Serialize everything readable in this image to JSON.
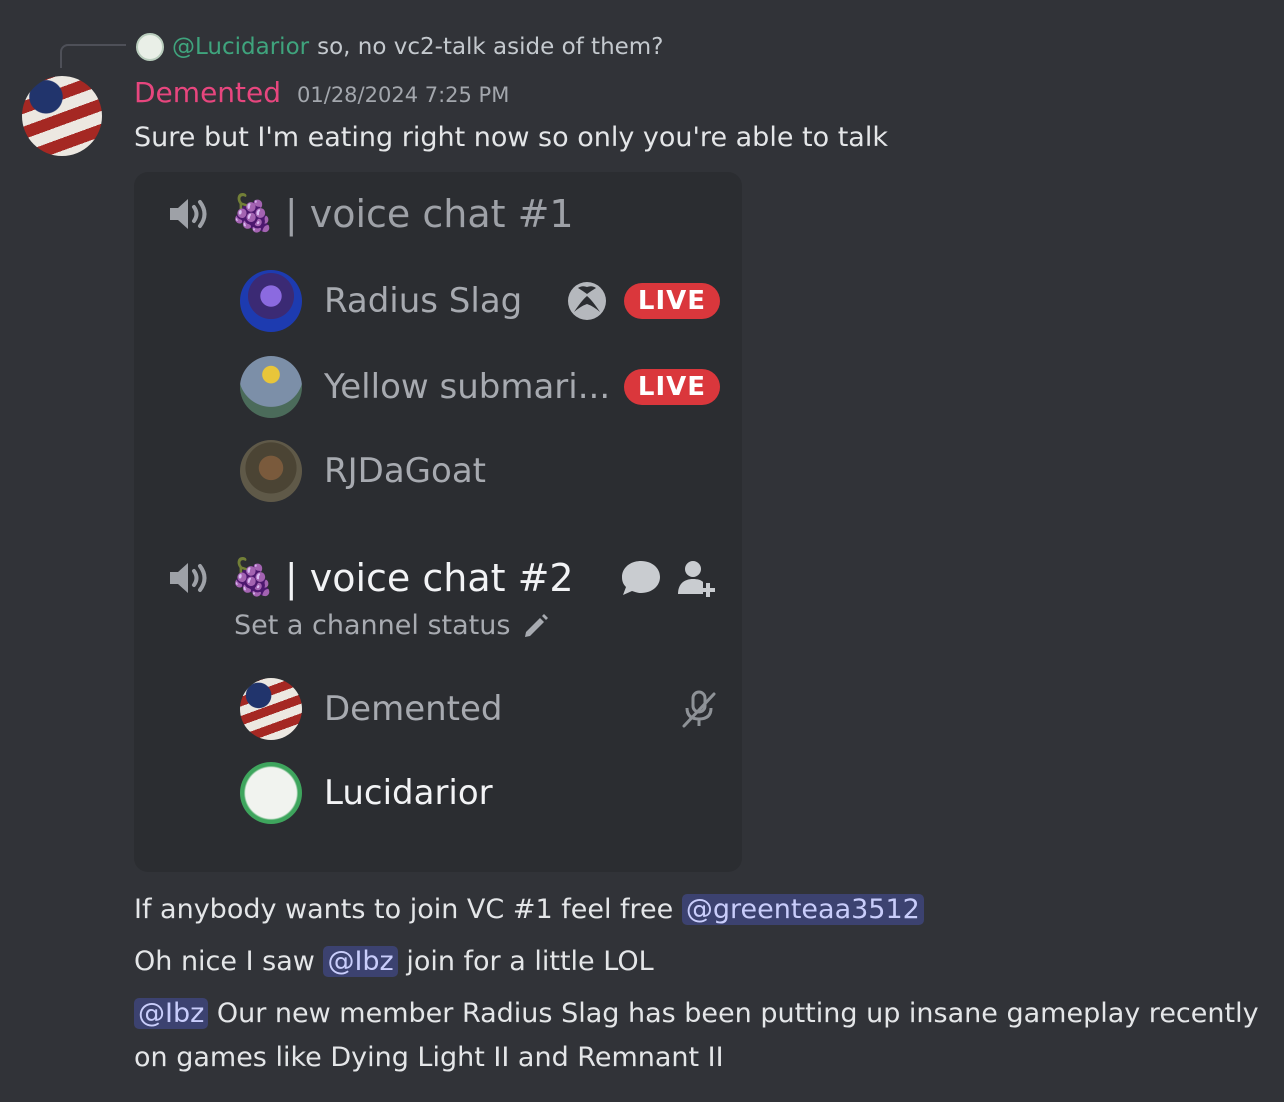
{
  "reply": {
    "name": "@Lucidarior",
    "text": "so, no vc2-talk aside of them?"
  },
  "message": {
    "author": "Demented",
    "timestamp": "01/28/2024 7:25 PM",
    "text": "Sure but I'm eating right now so only you're able to talk"
  },
  "embed": {
    "channel1": {
      "emoji": "🍇",
      "name": "| voice chat #1",
      "members": [
        {
          "name": "Radius Slag",
          "badge": "LIVE",
          "activity_icon": "xbox-icon"
        },
        {
          "name": "Yellow submari...",
          "badge": "LIVE"
        },
        {
          "name": "RJDaGoat"
        }
      ]
    },
    "channel2": {
      "emoji": "🍇",
      "name": "| voice chat #2",
      "status_placeholder": "Set a channel status",
      "members": [
        {
          "name": "Demented",
          "muted": true
        },
        {
          "name": "Lucidarior"
        }
      ]
    }
  },
  "followups": [
    {
      "text": "If anybody wants to join VC #1 feel free",
      "mention": "@greenteaa3512"
    },
    {
      "text_before": "Oh nice I saw",
      "mention": "@Ibz",
      "text_after": "join for a little LOL"
    },
    {
      "mention": "@Ibz",
      "line1": "Our new member Radius Slag has been putting up insane gameplay recently",
      "line2": "on games like Dying Light II and Remnant II"
    }
  ],
  "colors": {
    "background": "#313338",
    "embed_bg": "#2b2d31",
    "author": "#e7467e",
    "reply_name": "#3fa47d",
    "live_badge": "#da373c",
    "mention_bg": "#3c4270"
  }
}
